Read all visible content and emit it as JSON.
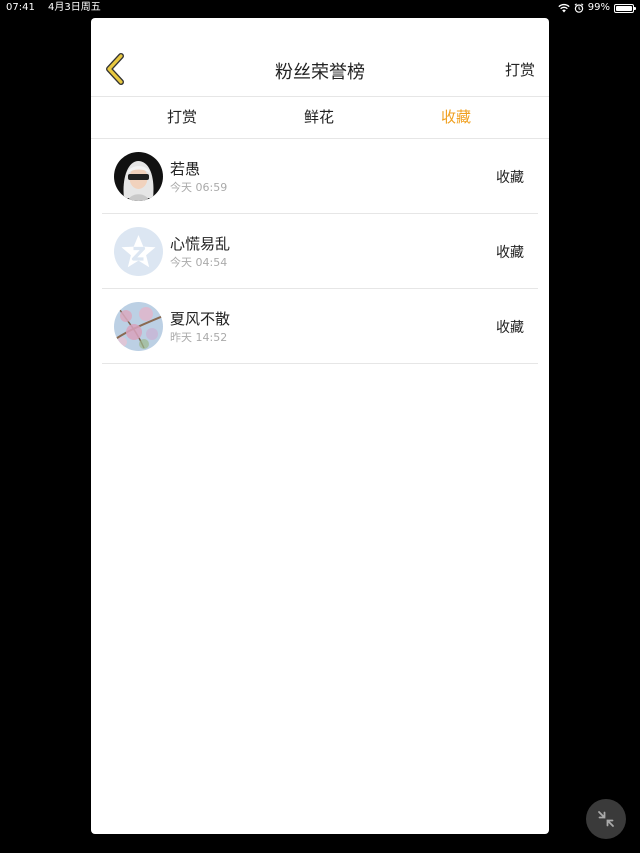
{
  "status_bar": {
    "time": "07:41",
    "date": "4月3日周五",
    "battery": "99%",
    "battery_level": 0.99,
    "icons": [
      "wifi-icon",
      "alarm-icon",
      "battery-icon"
    ]
  },
  "nav": {
    "title": "粉丝荣誉榜",
    "action_label": "打赏",
    "back_icon": "chevron-left-icon"
  },
  "tabs": [
    {
      "label": "打赏",
      "active": false
    },
    {
      "label": "鲜花",
      "active": false
    },
    {
      "label": "收藏",
      "active": true
    }
  ],
  "fans": [
    {
      "name": "若愚",
      "time": "今天 06:59",
      "action": "收藏",
      "avatar": "white-haired-character-avatar"
    },
    {
      "name": "心慌易乱",
      "time": "今天 04:54",
      "action": "收藏",
      "avatar": "default-qq-star-avatar"
    },
    {
      "name": "夏风不散",
      "time": "昨天 14:52",
      "action": "收藏",
      "avatar": "blossom-branch-avatar"
    }
  ],
  "colors": {
    "accent": "#f0a020",
    "back_arrow": "#e8c840",
    "text": "#222222",
    "subtext": "#aaaaaa"
  },
  "floating_button": {
    "icon": "minimize-icon"
  }
}
